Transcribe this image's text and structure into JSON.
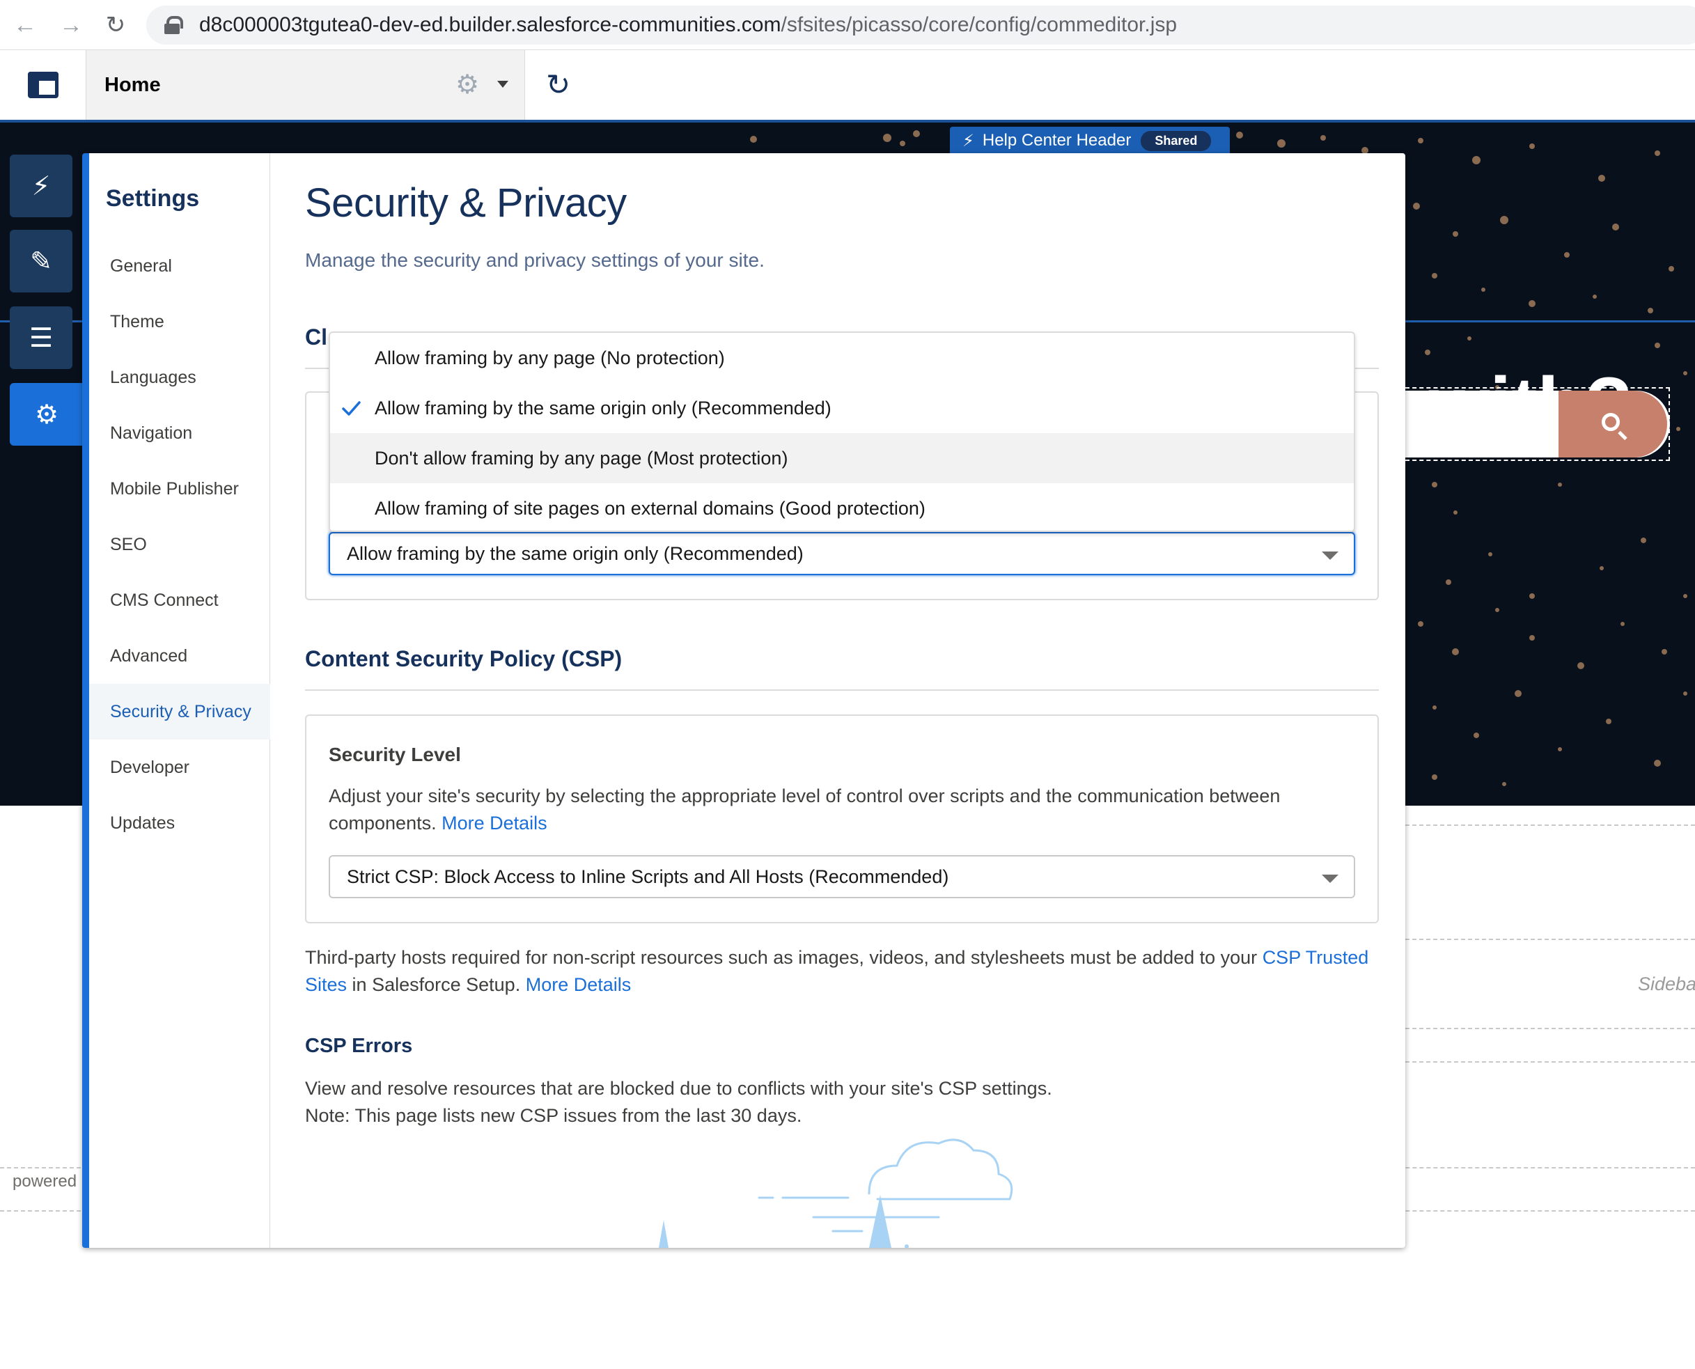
{
  "browser": {
    "url_host": "d8c000003tgutea0-dev-ed.builder.salesforce-communities.com",
    "url_path": "/sfsites/picasso/core/config/commeditor.jsp"
  },
  "builder_header": {
    "page_name": "Home"
  },
  "site_preview": {
    "hero_text": "with?",
    "component_tag": "Help Center Header",
    "component_badge": "Shared",
    "sidebar_label": "Sideba",
    "footer_label": "powered"
  },
  "settings_nav": {
    "title": "Settings",
    "items": [
      {
        "label": "General"
      },
      {
        "label": "Theme"
      },
      {
        "label": "Languages"
      },
      {
        "label": "Navigation"
      },
      {
        "label": "Mobile Publisher"
      },
      {
        "label": "SEO"
      },
      {
        "label": "CMS Connect"
      },
      {
        "label": "Advanced"
      },
      {
        "label": "Security & Privacy"
      },
      {
        "label": "Developer"
      },
      {
        "label": "Updates"
      }
    ],
    "selected": "Security & Privacy"
  },
  "content": {
    "title": "Security & Privacy",
    "subtitle": "Manage the security and privacy settings of your site.",
    "clickjack": {
      "heading_visible_part": "Cl",
      "selected_value": "Allow framing by the same origin only (Recommended)",
      "options": [
        {
          "label": "Allow framing by any page (No protection)",
          "checked": false,
          "hovered": false
        },
        {
          "label": "Allow framing by the same origin only (Recommended)",
          "checked": true,
          "hovered": false
        },
        {
          "label": "Don't allow framing by any page (Most protection)",
          "checked": false,
          "hovered": true
        },
        {
          "label": "Allow framing of site pages on external domains (Good protection)",
          "checked": false,
          "hovered": false
        }
      ]
    },
    "csp": {
      "heading": "Content Security Policy (CSP)",
      "security_level_title": "Security Level",
      "security_level_desc": "Adjust your site's security by selecting the appropriate level of control over scripts and the communication between components.",
      "more_details": "More Details",
      "selected_value": "Strict CSP: Block Access to Inline Scripts and All Hosts (Recommended)",
      "third_party_text_a": "Third-party hosts required for non-script resources such as images, videos, and stylesheets must be added to your",
      "csp_trusted_sites": "CSP Trusted Sites",
      "third_party_text_b": "in Salesforce Setup.",
      "more_details_2": "More Details",
      "errors_heading": "CSP Errors",
      "errors_line1": "View and resolve resources that are blocked due to conflicts with your site's CSP settings.",
      "errors_line2": "Note: This page lists new CSP issues from the last 30 days."
    }
  },
  "colors": {
    "brand_blue": "#1b6fd8",
    "navy": "#16325c",
    "search_button": "#c6806c",
    "site_background": "#08101c"
  },
  "icons": {
    "rail": [
      "lightning-icon",
      "paintbrush-icon",
      "list-icon",
      "gear-icon"
    ]
  }
}
